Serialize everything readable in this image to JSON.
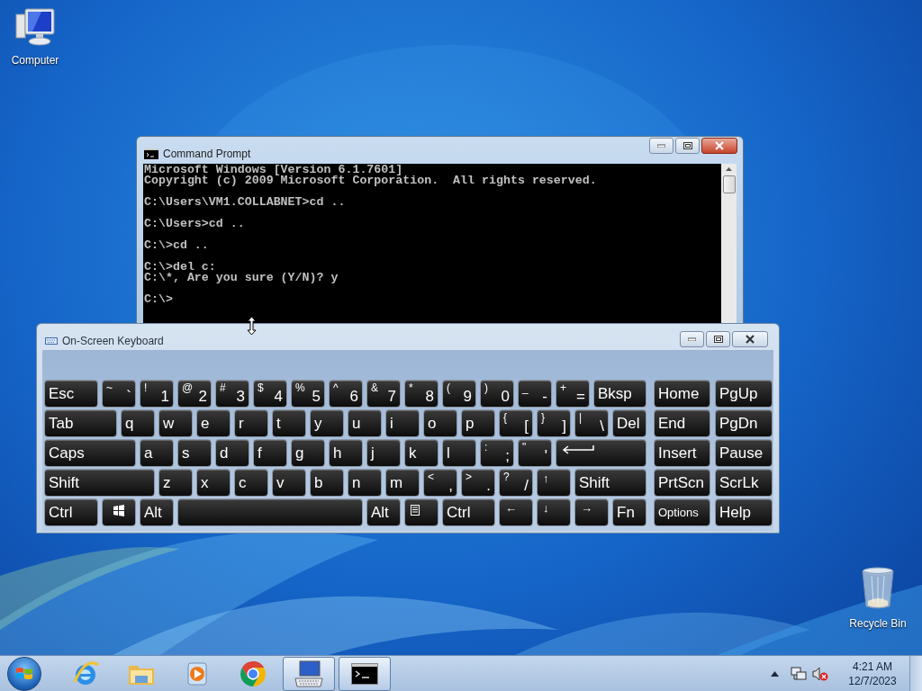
{
  "desktop_icons": [
    {
      "label": "Computer",
      "kind": "computer"
    },
    {
      "label": "Recycle Bin",
      "kind": "recycle"
    }
  ],
  "command_prompt": {
    "title": "Command Prompt",
    "output_blocks": [
      [
        "Microsoft Windows [Version 6.1.7601]",
        "Copyright (c) 2009 Microsoft Corporation.  All rights reserved."
      ],
      [
        "C:\\Users\\VM1.COLLABNET>cd .."
      ],
      [
        "C:\\Users>cd .."
      ],
      [
        "C:\\>cd .."
      ],
      [
        "C:\\>del c:",
        "C:\\*, Are you sure (Y/N)? y"
      ],
      [
        "C:\\>"
      ]
    ]
  },
  "on_screen_keyboard": {
    "title": "On-Screen Keyboard",
    "main_rows": [
      [
        {
          "kind": "word",
          "label": "Esc"
        },
        {
          "kind": "char",
          "shift": "~",
          "label": "`"
        },
        {
          "kind": "char",
          "shift": "!",
          "label": "1"
        },
        {
          "kind": "char",
          "shift": "@",
          "label": "2"
        },
        {
          "kind": "char",
          "shift": "#",
          "label": "3"
        },
        {
          "kind": "char",
          "shift": "$",
          "label": "4"
        },
        {
          "kind": "char",
          "shift": "%",
          "label": "5"
        },
        {
          "kind": "char",
          "shift": "^",
          "label": "6"
        },
        {
          "kind": "char",
          "shift": "&",
          "label": "7"
        },
        {
          "kind": "char",
          "shift": "*",
          "label": "8"
        },
        {
          "kind": "char",
          "shift": "(",
          "label": "9"
        },
        {
          "kind": "char",
          "shift": ")",
          "label": "0"
        },
        {
          "kind": "char",
          "shift": "_",
          "label": "-"
        },
        {
          "kind": "char",
          "shift": "+",
          "label": "="
        },
        {
          "kind": "word",
          "label": "Bksp"
        }
      ],
      [
        {
          "kind": "word",
          "label": "Tab"
        },
        {
          "kind": "word",
          "label": "q"
        },
        {
          "kind": "word",
          "label": "w"
        },
        {
          "kind": "word",
          "label": "e"
        },
        {
          "kind": "word",
          "label": "r"
        },
        {
          "kind": "word",
          "label": "t"
        },
        {
          "kind": "word",
          "label": "y"
        },
        {
          "kind": "word",
          "label": "u"
        },
        {
          "kind": "word",
          "label": "i"
        },
        {
          "kind": "word",
          "label": "o"
        },
        {
          "kind": "word",
          "label": "p"
        },
        {
          "kind": "char",
          "shift": "{",
          "label": "["
        },
        {
          "kind": "char",
          "shift": "}",
          "label": "]"
        },
        {
          "kind": "char",
          "shift": "|",
          "label": "\\"
        },
        {
          "kind": "word",
          "label": "Del"
        }
      ],
      [
        {
          "kind": "word",
          "label": "Caps"
        },
        {
          "kind": "word",
          "label": "a"
        },
        {
          "kind": "word",
          "label": "s"
        },
        {
          "kind": "word",
          "label": "d"
        },
        {
          "kind": "word",
          "label": "f"
        },
        {
          "kind": "word",
          "label": "g"
        },
        {
          "kind": "word",
          "label": "h"
        },
        {
          "kind": "word",
          "label": "j"
        },
        {
          "kind": "word",
          "label": "k"
        },
        {
          "kind": "word",
          "label": "l"
        },
        {
          "kind": "char",
          "shift": ":",
          "label": ";"
        },
        {
          "kind": "char",
          "shift": "\"",
          "label": "'"
        },
        {
          "kind": "enter"
        }
      ],
      [
        {
          "kind": "word",
          "label": "Shift"
        },
        {
          "kind": "word",
          "label": "z"
        },
        {
          "kind": "word",
          "label": "x"
        },
        {
          "kind": "word",
          "label": "c"
        },
        {
          "kind": "word",
          "label": "v"
        },
        {
          "kind": "word",
          "label": "b"
        },
        {
          "kind": "word",
          "label": "n"
        },
        {
          "kind": "word",
          "label": "m"
        },
        {
          "kind": "char",
          "shift": "<",
          "label": ","
        },
        {
          "kind": "char",
          "shift": ">",
          "label": "."
        },
        {
          "kind": "char",
          "shift": "?",
          "label": "/"
        },
        {
          "kind": "arrow",
          "label": "↑"
        },
        {
          "kind": "word",
          "label": "Shift"
        }
      ],
      [
        {
          "kind": "word",
          "label": "Ctrl"
        },
        {
          "kind": "windows"
        },
        {
          "kind": "word",
          "label": "Alt"
        },
        {
          "kind": "space"
        },
        {
          "kind": "word",
          "label": "Alt"
        },
        {
          "kind": "menu"
        },
        {
          "kind": "word",
          "label": "Ctrl"
        },
        {
          "kind": "arrow",
          "label": "←"
        },
        {
          "kind": "arrow",
          "label": "↓"
        },
        {
          "kind": "arrow",
          "label": "→"
        },
        {
          "kind": "word",
          "label": "Fn"
        }
      ]
    ],
    "side_rows": [
      [
        {
          "kind": "word",
          "label": "Home"
        },
        {
          "kind": "word",
          "label": "PgUp"
        }
      ],
      [
        {
          "kind": "word",
          "label": "End"
        },
        {
          "kind": "word",
          "label": "PgDn"
        }
      ],
      [
        {
          "kind": "word",
          "label": "Insert"
        },
        {
          "kind": "word",
          "label": "Pause"
        }
      ],
      [
        {
          "kind": "word",
          "label": "PrtScn"
        },
        {
          "kind": "word",
          "label": "ScrLk"
        }
      ],
      [
        {
          "kind": "small",
          "label": "Options"
        },
        {
          "kind": "word",
          "label": "Help"
        }
      ]
    ]
  },
  "taskbar": {
    "items": [
      {
        "kind": "ie",
        "running": false
      },
      {
        "kind": "explorer",
        "running": false
      },
      {
        "kind": "media",
        "running": false
      },
      {
        "kind": "chrome",
        "running": false
      },
      {
        "kind": "keyboard",
        "running": true
      },
      {
        "kind": "cmd",
        "running": true
      }
    ],
    "clock": {
      "time": "4:21 AM",
      "date": "12/7/2023"
    }
  }
}
